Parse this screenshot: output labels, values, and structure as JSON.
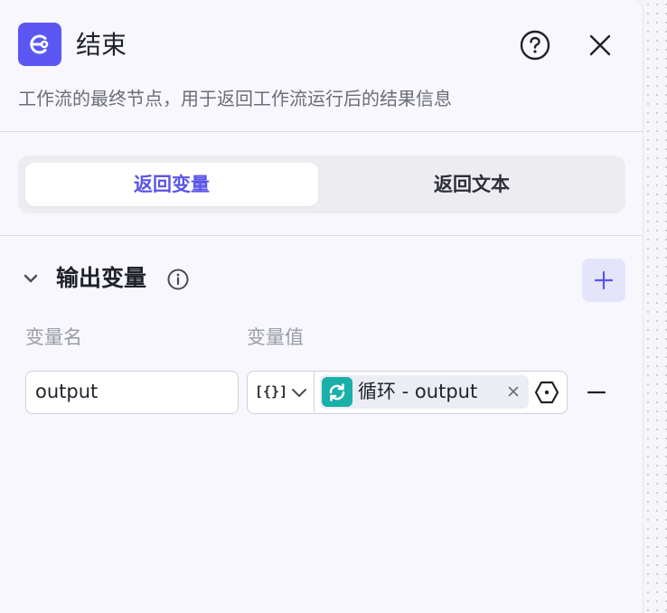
{
  "panel": {
    "title": "结束",
    "description": "工作流的最终节点，用于返回工作流运行后的结果信息",
    "node_icon": "end-node-icon",
    "accent_color": "#5c57f2"
  },
  "tabs": [
    {
      "label": "返回变量",
      "active": true
    },
    {
      "label": "返回文本",
      "active": false
    }
  ],
  "output_section": {
    "title": "输出变量",
    "expanded": true,
    "columns": {
      "name": "变量名",
      "value": "变量值"
    },
    "rows": [
      {
        "name": "output",
        "type_glyph": "[{}]",
        "reference": "循环 - output",
        "reference_icon": "loop-icon",
        "reference_icon_color": "#18b0a8"
      }
    ]
  }
}
